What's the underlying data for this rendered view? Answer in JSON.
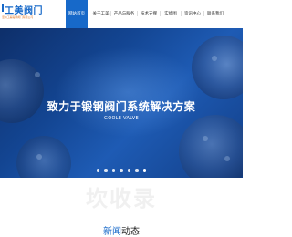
{
  "header": {
    "logo_title": "工美阀门",
    "logo_subtitle": "温州工美锻钢阀门有限公司"
  },
  "nav": {
    "items": [
      {
        "label": "网站首页",
        "active": true
      },
      {
        "label": "关于工美",
        "active": false
      },
      {
        "label": "产品与服务",
        "active": false
      },
      {
        "label": "技术支撑",
        "active": false
      },
      {
        "label": "实绩图",
        "active": false
      },
      {
        "label": "资讯中心",
        "active": false
      },
      {
        "label": "联系我们",
        "active": false
      }
    ]
  },
  "banner": {
    "title": "致力于锻钢阀门系统解决方案",
    "subtitle": "GOOLE VALVE",
    "slide_count": 7,
    "active_slide": 6
  },
  "news": {
    "watermark": "坎收录",
    "title_part1": "新闻",
    "title_part2": "动态"
  },
  "colors": {
    "accent": "#1769c9",
    "logo_sub": "#e0731f"
  }
}
